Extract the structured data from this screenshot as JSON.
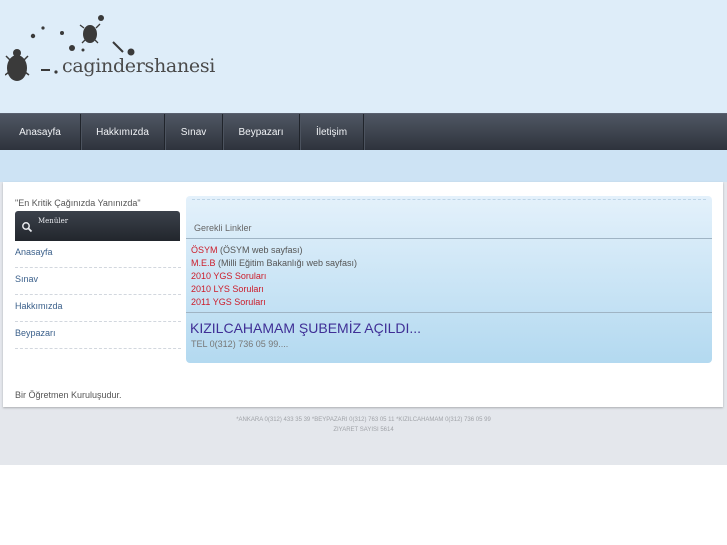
{
  "site": {
    "logo_text": "cagindershanesi",
    "slogan": "\"En Kritik Çağınızda Yanınızda\"",
    "footer_note": "Bir Öğretmen Kuruluşudur."
  },
  "nav": {
    "items": [
      {
        "label": "Anasayfa"
      },
      {
        "label": "Hakkımızda"
      },
      {
        "label": "Sınav"
      },
      {
        "label": "Beypazarı"
      },
      {
        "label": "İletişim"
      }
    ]
  },
  "sidebar": {
    "header": "Menüler",
    "items": [
      {
        "label": "Anasayfa"
      },
      {
        "label": "Sınav"
      },
      {
        "label": "Hakkımızda"
      },
      {
        "label": "Beypazarı"
      }
    ]
  },
  "panel": {
    "title": "Gerekli Linkler",
    "links": [
      {
        "label": "ÖSYM",
        "desc": " (ÖSYM web sayfası)"
      },
      {
        "label": "M.E.B",
        "desc": "  (Milli Eğitim Bakanlığı web sayfası)"
      },
      {
        "label": "2010 YGS Soruları",
        "desc": ""
      },
      {
        "label": "2010 LYS Soruları",
        "desc": ""
      },
      {
        "label": "2011 YGS Soruları",
        "desc": ""
      }
    ],
    "news_title": "KIZILCAHAMAM ŞUBEMİZ AÇILDI...",
    "news_tel": "TEL 0(312) 736 05 99...."
  },
  "footer": {
    "phones": "*ANKARA 0(312) 433 35 39 *BEYPAZARI 0(312) 763 05 11 *KIZILCAHAMAM 0(312) 736 05 99",
    "visits": "ZIYARET SAYISI 5614"
  },
  "colors": {
    "header_bg": "#deedf9",
    "navbar": "#2d323b",
    "link_red": "#cc1c2a",
    "news_purple": "#3f2f96",
    "sidebar_link": "#3a5f8a"
  }
}
